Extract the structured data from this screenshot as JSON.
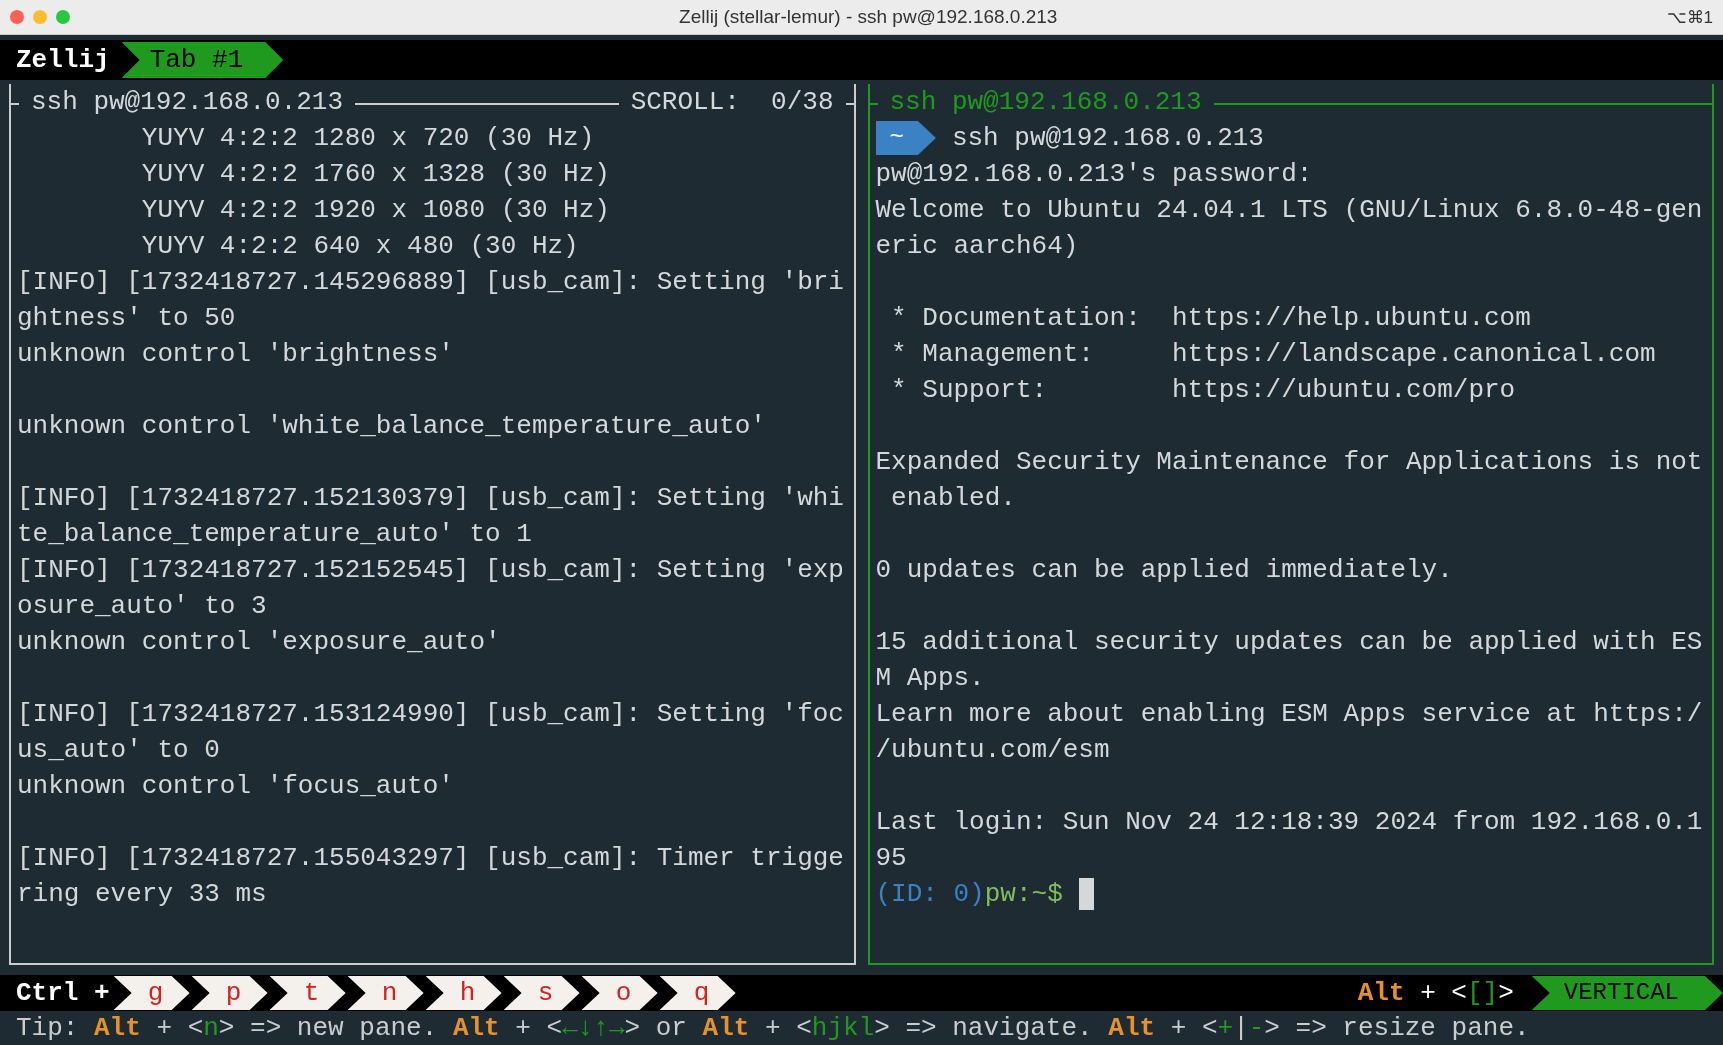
{
  "window": {
    "title": "Zellij (stellar-lemur) - ssh pw@192.168.0.213",
    "shortcut": "⌥⌘1"
  },
  "tab_bar": {
    "session": "Zellij",
    "tabs": [
      {
        "label": "Tab #1",
        "selected": true
      }
    ]
  },
  "panes": [
    {
      "title": "ssh pw@192.168.0.213",
      "scroll": "SCROLL:  0/38",
      "focused": false,
      "lines": [
        {
          "kind": "text",
          "text": "        YUYV 4:2:2 1280 x 720 (30 Hz)"
        },
        {
          "kind": "text",
          "text": "        YUYV 4:2:2 1760 x 1328 (30 Hz)"
        },
        {
          "kind": "text",
          "text": "        YUYV 4:2:2 1920 x 1080 (30 Hz)"
        },
        {
          "kind": "text",
          "text": "        YUYV 4:2:2 640 x 480 (30 Hz)"
        },
        {
          "kind": "text",
          "text": "[INFO] [1732418727.145296889] [usb_cam]: Setting 'bri"
        },
        {
          "kind": "text",
          "text": "ghtness' to 50"
        },
        {
          "kind": "text",
          "text": "unknown control 'brightness'"
        },
        {
          "kind": "blank"
        },
        {
          "kind": "text",
          "text": "unknown control 'white_balance_temperature_auto'"
        },
        {
          "kind": "blank"
        },
        {
          "kind": "text",
          "text": "[INFO] [1732418727.152130379] [usb_cam]: Setting 'whi"
        },
        {
          "kind": "text",
          "text": "te_balance_temperature_auto' to 1"
        },
        {
          "kind": "text",
          "text": "[INFO] [1732418727.152152545] [usb_cam]: Setting 'exp"
        },
        {
          "kind": "text",
          "text": "osure_auto' to 3"
        },
        {
          "kind": "text",
          "text": "unknown control 'exposure_auto'"
        },
        {
          "kind": "blank"
        },
        {
          "kind": "text",
          "text": "[INFO] [1732418727.153124990] [usb_cam]: Setting 'foc"
        },
        {
          "kind": "text",
          "text": "us_auto' to 0"
        },
        {
          "kind": "text",
          "text": "unknown control 'focus_auto'"
        },
        {
          "kind": "blank"
        },
        {
          "kind": "text",
          "text": "[INFO] [1732418727.155043297] [usb_cam]: Timer trigge"
        },
        {
          "kind": "text",
          "text": "ring every 33 ms"
        }
      ]
    },
    {
      "title": "ssh pw@192.168.0.213",
      "focused": true,
      "lines": [
        {
          "kind": "prompt",
          "dir": "~",
          "text": "ssh pw@192.168.0.213"
        },
        {
          "kind": "text",
          "text": "pw@192.168.0.213's password:"
        },
        {
          "kind": "text",
          "text": "Welcome to Ubuntu 24.04.1 LTS (GNU/Linux 6.8.0-48-gen"
        },
        {
          "kind": "text",
          "text": "eric aarch64)"
        },
        {
          "kind": "blank"
        },
        {
          "kind": "text",
          "text": " * Documentation:  https://help.ubuntu.com"
        },
        {
          "kind": "text",
          "text": " * Management:     https://landscape.canonical.com"
        },
        {
          "kind": "text",
          "text": " * Support:        https://ubuntu.com/pro"
        },
        {
          "kind": "blank"
        },
        {
          "kind": "text",
          "text": "Expanded Security Maintenance for Applications is not"
        },
        {
          "kind": "text",
          "text": " enabled."
        },
        {
          "kind": "blank"
        },
        {
          "kind": "text",
          "text": "0 updates can be applied immediately."
        },
        {
          "kind": "blank"
        },
        {
          "kind": "text",
          "text": "15 additional security updates can be applied with ES"
        },
        {
          "kind": "text",
          "text": "M Apps."
        },
        {
          "kind": "text",
          "text": "Learn more about enabling ESM Apps service at https:/"
        },
        {
          "kind": "text",
          "text": "/ubuntu.com/esm"
        },
        {
          "kind": "blank"
        },
        {
          "kind": "text",
          "text": "Last login: Sun Nov 24 12:18:39 2024 from 192.168.0.1"
        },
        {
          "kind": "text",
          "text": "95"
        },
        {
          "kind": "shell",
          "id": "(ID: 0)",
          "text": "pw:~$",
          "cursor": true
        }
      ]
    }
  ],
  "status_bar": {
    "modifier": "Ctrl +",
    "keys": [
      {
        "label": "g",
        "selected": false
      },
      {
        "label": "p",
        "selected": false
      },
      {
        "label": "t",
        "selected": false
      },
      {
        "label": "n",
        "selected": false
      },
      {
        "label": "h",
        "selected": false
      },
      {
        "label": "s",
        "selected": false
      },
      {
        "label": "o",
        "selected": false
      },
      {
        "label": "q",
        "selected": false
      }
    ],
    "swap_hint": [
      {
        "kind": "key",
        "text": "Alt"
      },
      {
        "kind": "plain",
        "text": " + <"
      },
      {
        "kind": "hint",
        "text": "[]"
      },
      {
        "kind": "plain",
        "text": ">"
      }
    ],
    "layout": "VERTICAL"
  },
  "tip": [
    {
      "kind": "plain",
      "text": "Tip: "
    },
    {
      "kind": "key",
      "text": "Alt"
    },
    {
      "kind": "plain",
      "text": " + <"
    },
    {
      "kind": "hint",
      "text": "n"
    },
    {
      "kind": "plain",
      "text": "> => new pane. "
    },
    {
      "kind": "key",
      "text": "Alt"
    },
    {
      "kind": "plain",
      "text": " + <"
    },
    {
      "kind": "hint",
      "text": "←↓↑→"
    },
    {
      "kind": "plain",
      "text": "> or "
    },
    {
      "kind": "key",
      "text": "Alt"
    },
    {
      "kind": "plain",
      "text": " + <"
    },
    {
      "kind": "hint",
      "text": "hjkl"
    },
    {
      "kind": "plain",
      "text": "> => navigate. "
    },
    {
      "kind": "key",
      "text": "Alt"
    },
    {
      "kind": "plain",
      "text": " + <"
    },
    {
      "kind": "hint",
      "text": "+"
    },
    {
      "kind": "plain",
      "text": "|"
    },
    {
      "kind": "hint",
      "text": "-"
    },
    {
      "kind": "plain",
      "text": "> => resize pane."
    }
  ]
}
